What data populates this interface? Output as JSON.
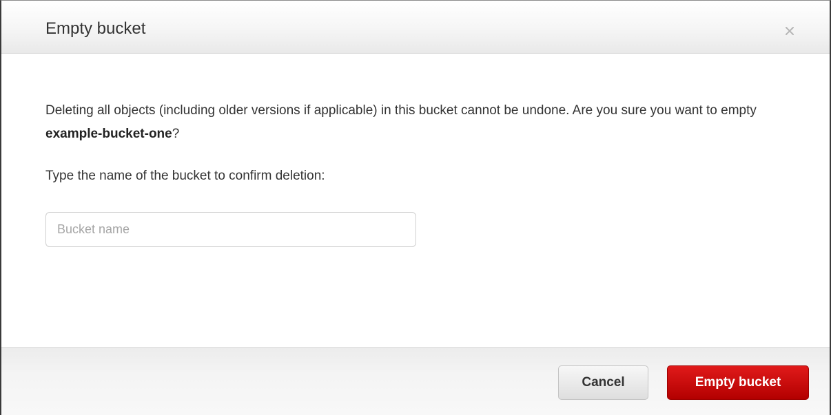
{
  "dialog": {
    "title": "Empty bucket",
    "close_icon": "close-icon",
    "message_prefix": "Deleting all objects (including older versions if applicable) in this bucket cannot be undone. Are you sure you want to empty ",
    "bucket_name": "example-bucket-one",
    "message_suffix": "?",
    "confirm_label": "Type the name of the bucket to confirm deletion:",
    "input": {
      "value": "",
      "placeholder": "Bucket name"
    },
    "buttons": {
      "cancel_label": "Cancel",
      "confirm_label": "Empty bucket"
    },
    "colors": {
      "primary_button": "#cc0000",
      "text": "#333333"
    }
  }
}
